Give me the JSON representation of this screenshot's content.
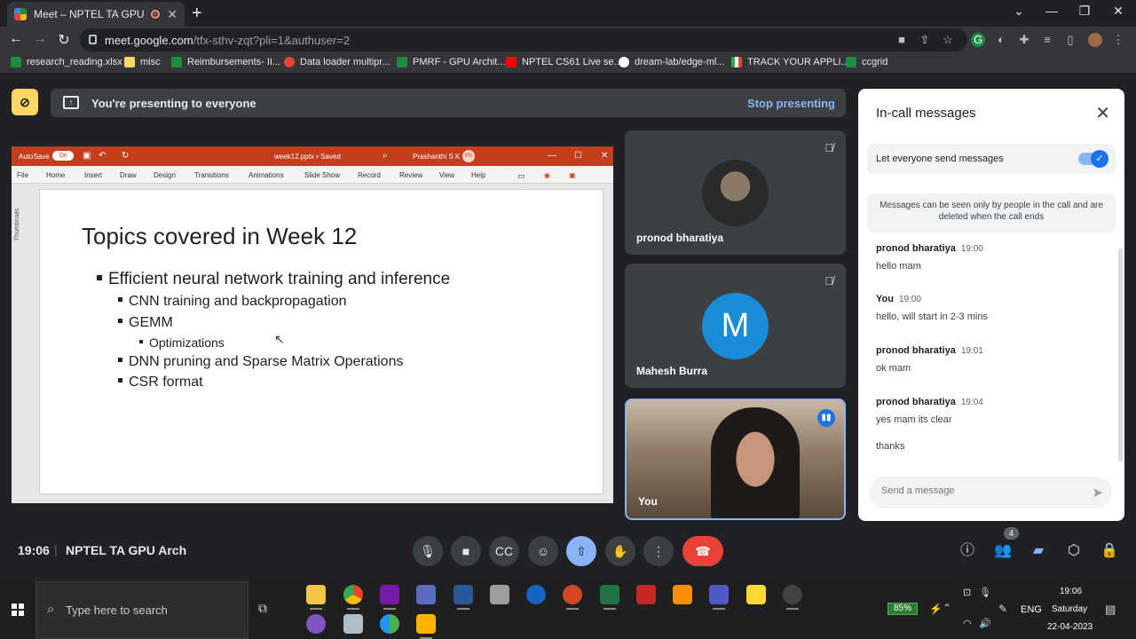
{
  "browser": {
    "tab_title": "Meet – NPTEL TA GPU Arch",
    "url_host": "meet.google.com",
    "url_path": "/tfx-sthv-zqt?pli=1&authuser=2",
    "bookmarks": [
      {
        "label": "research_reading.xlsx",
        "color": "#1e8e3e"
      },
      {
        "label": "misc",
        "color": "#fdd663"
      },
      {
        "label": "Reimbursements- II...",
        "color": "#1e8e3e"
      },
      {
        "label": "Data loader multipr...",
        "color": "#ea4335"
      },
      {
        "label": "PMRF - GPU Archit...",
        "color": "#1e8e3e"
      },
      {
        "label": "NPTEL CS61 Live se...",
        "color": "#ff0000"
      },
      {
        "label": "dream-lab/edge-ml...",
        "color": "#ffffff"
      },
      {
        "label": "TRACK YOUR APPLI...",
        "color": "#34a853"
      },
      {
        "label": "ccgrid",
        "color": "#1e8e3e"
      }
    ]
  },
  "presenting": {
    "message": "You're presenting to everyone",
    "stop_label": "Stop presenting"
  },
  "powerpoint": {
    "autosave": "AutoSave",
    "autosave_state": "On",
    "file_name": "week12.pptx • Saved",
    "user": "Prashanthi S K",
    "user_initials": "PS",
    "ribbon_tabs": [
      "File",
      "Home",
      "Insert",
      "Draw",
      "Design",
      "Transitions",
      "Animations",
      "Slide Show",
      "Record",
      "Review",
      "View",
      "Help"
    ],
    "thumbnails_label": "Thumbnails",
    "slide": {
      "title": "Topics covered in Week 12",
      "bullets": [
        {
          "level": 1,
          "text": "Efficient neural network training and inference"
        },
        {
          "level": 2,
          "text": "CNN training and backpropagation"
        },
        {
          "level": 2,
          "text": "GEMM"
        },
        {
          "level": 3,
          "text": "Optimizations"
        },
        {
          "level": 2,
          "text": "DNN pruning and Sparse Matrix Operations"
        },
        {
          "level": 2,
          "text": "CSR format"
        }
      ]
    }
  },
  "participants": [
    {
      "name": "pronod bharatiya"
    },
    {
      "name": "Mahesh Burra",
      "initial": "M",
      "color": "#1a8cd8"
    },
    {
      "name": "You"
    }
  ],
  "chat": {
    "title": "In-call messages",
    "toggle_label": "Let everyone send messages",
    "toggle_on": true,
    "notice": "Messages can be seen only by people in the call and are deleted when the call ends",
    "messages": [
      {
        "sender": "pronod bharatiya",
        "time": "19:00",
        "texts": [
          "hello mam"
        ]
      },
      {
        "sender": "You",
        "time": "19:00",
        "texts": [
          "hello, will start in 2-3 mins"
        ]
      },
      {
        "sender": "pronod bharatiya",
        "time": "19:01",
        "texts": [
          "ok mam"
        ]
      },
      {
        "sender": "pronod bharatiya",
        "time": "19:04",
        "texts": [
          "yes mam its clear",
          "thanks"
        ]
      }
    ],
    "input_placeholder": "Send a message"
  },
  "meeting": {
    "clock": "19:06",
    "separator": "|",
    "name": "NPTEL TA GPU Arch",
    "people_count": "4"
  },
  "taskbar": {
    "search_placeholder": "Type here to search",
    "battery": "85%",
    "language": "ENG",
    "time": "19:06",
    "day": "Saturday",
    "date": "22-04-2023"
  }
}
